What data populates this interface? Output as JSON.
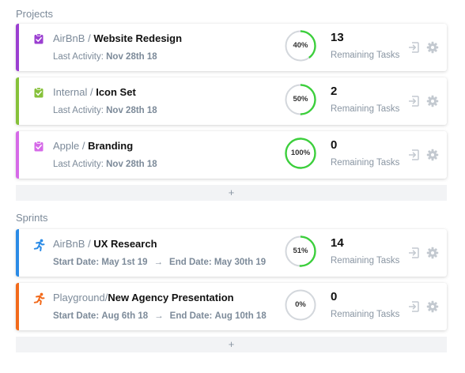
{
  "projects": {
    "title": "Projects",
    "add_label": "+",
    "items": [
      {
        "client": "AirBnB",
        "separator": " / ",
        "name": "Website Redesign",
        "activity_label": "Last Activity:",
        "activity_date": "Nov 28th 18",
        "progress_text": "40%",
        "progress": 0.4,
        "count": "13",
        "count_label": "Remaining Tasks",
        "stripe_color": "#9b3fd1",
        "icon": "clipboard-check-icon",
        "icon_color": "#9b3fd1"
      },
      {
        "client": "Internal",
        "separator": " / ",
        "name": "Icon Set",
        "activity_label": "Last Activity:",
        "activity_date": "Nov 28th 18",
        "progress_text": "50%",
        "progress": 0.5,
        "count": "2",
        "count_label": "Remaining Tasks",
        "stripe_color": "#86c13a",
        "icon": "clipboard-check-icon",
        "icon_color": "#86c13a"
      },
      {
        "client": "Apple",
        "separator": " / ",
        "name": "Branding",
        "activity_label": "Last Activity:",
        "activity_date": "Nov 28th 18",
        "progress_text": "100%",
        "progress": 1.0,
        "count": "0",
        "count_label": "Remaining Tasks",
        "stripe_color": "#d66ae8",
        "icon": "clipboard-check-icon",
        "icon_color": "#d66ae8"
      }
    ]
  },
  "sprints": {
    "title": "Sprints",
    "add_label": "+",
    "items": [
      {
        "client": "AirBnB",
        "separator": " / ",
        "name": "UX Research",
        "start_label": "Start Date:",
        "start_date": "May 1st 19",
        "arrow": "→",
        "end_label": "End Date:",
        "end_date": "May 30th 19",
        "progress_text": "51%",
        "progress": 0.51,
        "count": "14",
        "count_label": "Remaining Tasks",
        "stripe_color": "#2b8be6",
        "icon": "runner-icon",
        "icon_color": "#2b8be6"
      },
      {
        "client": "Playground",
        "separator": "/",
        "name": "New Agency Presentation",
        "start_label": "Start Date:",
        "start_date": "Aug 6th 18",
        "arrow": "→",
        "end_label": "End Date:",
        "end_date": "Aug 10th 18",
        "progress_text": "0%",
        "progress": 0,
        "count": "0",
        "count_label": "Remaining Tasks",
        "stripe_color": "#f26a1b",
        "icon": "runner-icon",
        "icon_color": "#f26a1b"
      }
    ]
  },
  "actions": {
    "open_icon": "sign-in-icon",
    "settings_icon": "gear-icon"
  },
  "colors": {
    "progress_fill": "#3ccf3c",
    "progress_track": "#d3d7dc",
    "action_icon": "#c3c9d0"
  }
}
